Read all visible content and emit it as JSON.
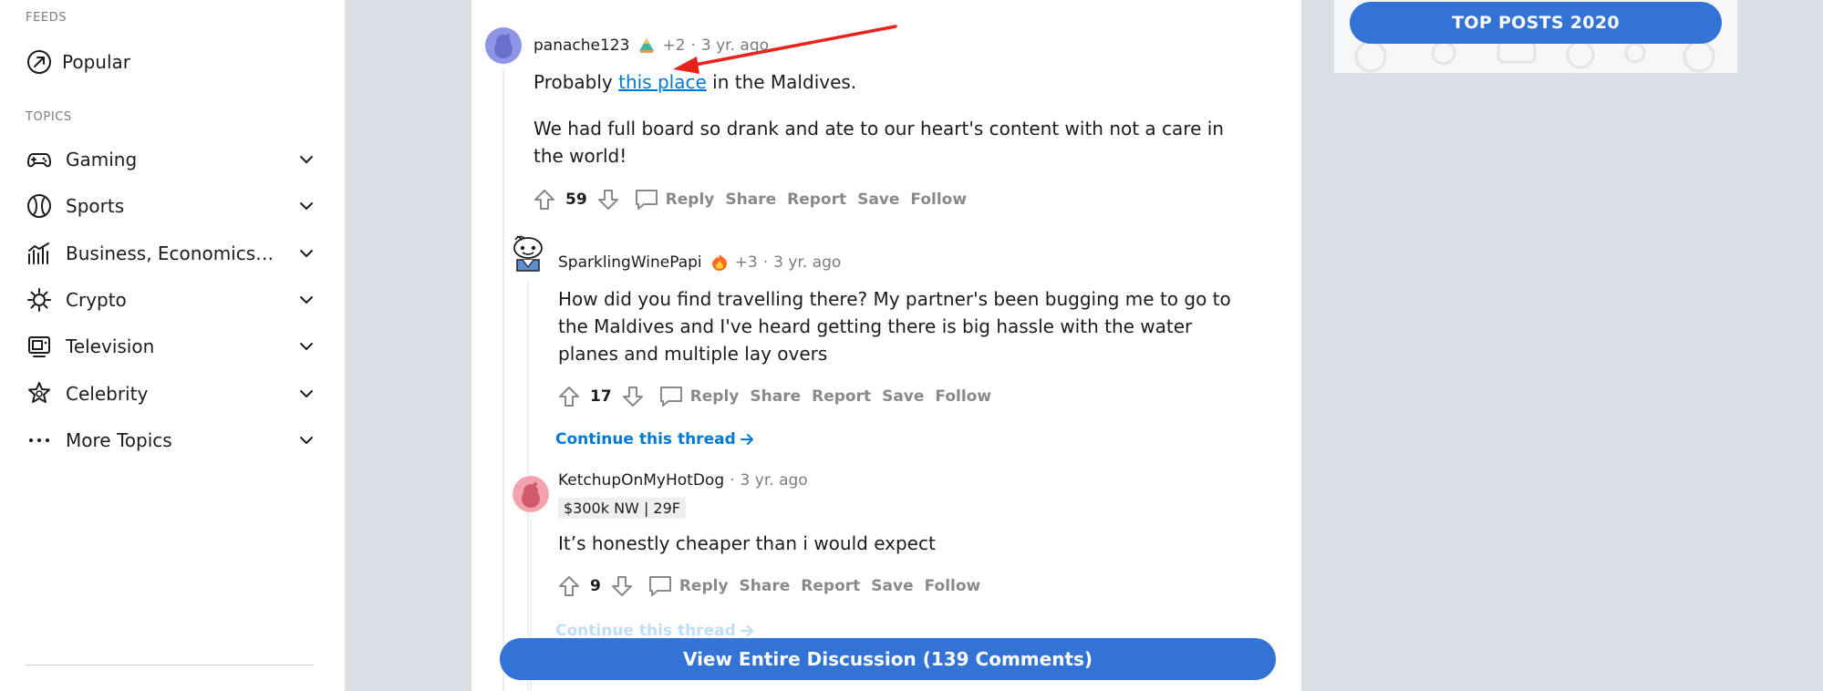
{
  "sidebar": {
    "feeds_label": "FEEDS",
    "popular_label": "Popular",
    "topics_label": "TOPICS",
    "topics": [
      {
        "label": "Gaming",
        "icon": "gamepad-icon"
      },
      {
        "label": "Sports",
        "icon": "sports-ball-icon"
      },
      {
        "label": "Business, Economics, and Finance",
        "icon": "chart-bar-icon"
      },
      {
        "label": "Crypto",
        "icon": "crypto-icon"
      },
      {
        "label": "Television",
        "icon": "television-icon"
      },
      {
        "label": "Celebrity",
        "icon": "celebrity-star-icon"
      },
      {
        "label": "More Topics",
        "icon": "more-dots-icon"
      }
    ]
  },
  "comments": [
    {
      "user": "panache123",
      "points": "+2",
      "time": "3 yr. ago",
      "text_before_link": "Probably ",
      "link_text": "this place",
      "text_after_link": " in the Maldives.",
      "paragraph2": "We had full board so drank and ate to our heart's content with not a care in the world!",
      "score": "59"
    },
    {
      "user": "SparklingWinePapi",
      "points": "+3",
      "time": "3 yr. ago",
      "text": "How did you find travelling there? My partner's been bugging me to go to the Maldives and I've heard getting there is big hassle with the water planes and multiple lay overs",
      "score": "17"
    },
    {
      "user": "KetchupOnMyHotDog",
      "time": "3 yr. ago",
      "flair": "$300k NW | 29F",
      "text": "It’s honestly cheaper than i would expect",
      "score": "9"
    }
  ],
  "actions": {
    "reply": "Reply",
    "share": "Share",
    "report": "Report",
    "save": "Save",
    "follow": "Follow"
  },
  "continue_thread": "Continue this thread",
  "view_discussion": "View Entire Discussion (139 Comments)",
  "top_posts": "TOP POSTS 2020",
  "colors": {
    "accent": "#3373d6",
    "link": "#0079d3",
    "annotation_arrow": "#e8231b",
    "page_bg": "#dae0e6"
  }
}
